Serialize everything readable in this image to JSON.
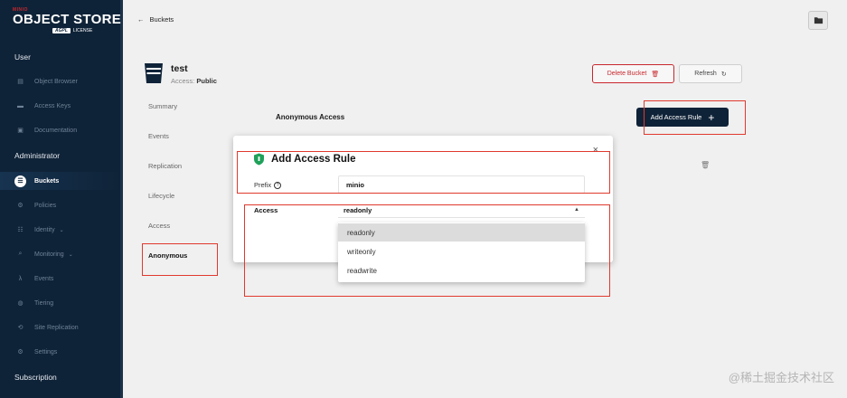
{
  "logo": {
    "brand": "MINIO",
    "title": "OBJECT STORE",
    "badge": "AGPL",
    "license": "LICENSE"
  },
  "sidebar": {
    "user_section": "User",
    "user_items": [
      {
        "label": "Object Browser",
        "icon": "object-browser-icon"
      },
      {
        "label": "Access Keys",
        "icon": "key-icon"
      },
      {
        "label": "Documentation",
        "icon": "documentation-icon"
      }
    ],
    "admin_section": "Administrator",
    "admin_items": [
      {
        "label": "Buckets",
        "icon": "bucket-icon",
        "active": true
      },
      {
        "label": "Policies",
        "icon": "policy-icon"
      },
      {
        "label": "Identity",
        "icon": "identity-icon",
        "caret": "⌄"
      },
      {
        "label": "Monitoring",
        "icon": "monitoring-icon",
        "caret": "⌄"
      },
      {
        "label": "Events",
        "icon": "lambda-icon"
      },
      {
        "label": "Tiering",
        "icon": "tiering-icon"
      },
      {
        "label": "Site Replication",
        "icon": "replication-icon"
      },
      {
        "label": "Settings",
        "icon": "settings-icon"
      }
    ],
    "subscription_section": "Subscription"
  },
  "header": {
    "back_label": "Buckets"
  },
  "bucket": {
    "name": "test",
    "access_label": "Access:",
    "access_value": "Public",
    "delete_label": "Delete Bucket",
    "refresh_label": "Refresh"
  },
  "tabs": [
    {
      "label": "Summary"
    },
    {
      "label": "Events"
    },
    {
      "label": "Replication"
    },
    {
      "label": "Lifecycle"
    },
    {
      "label": "Access"
    },
    {
      "label": "Anonymous",
      "active": true
    }
  ],
  "content": {
    "heading": "Anonymous Access",
    "add_rule_label": "Add Access Rule"
  },
  "modal": {
    "title": "Add Access Rule",
    "close": "×",
    "prefix_label": "Prefix",
    "prefix_value": "minio",
    "access_label": "Access",
    "access_value": "readonly"
  },
  "dropdown": {
    "options": [
      "readonly",
      "writeonly",
      "readwrite"
    ],
    "selected": "readonly"
  },
  "watermark": "@稀土掘金技术社区",
  "colors": {
    "sidebar": "#0f2338",
    "danger": "#c8272e",
    "annotation": "#e0392e"
  }
}
